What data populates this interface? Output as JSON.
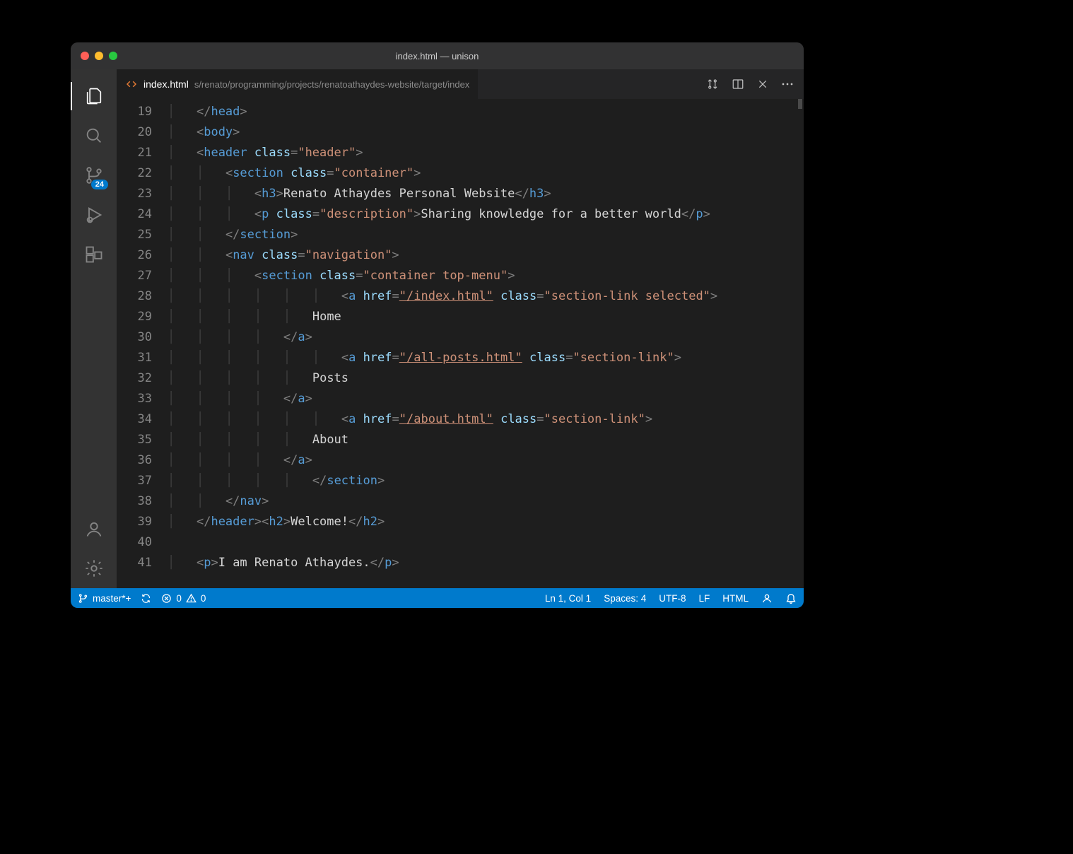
{
  "window": {
    "title": "index.html — unison"
  },
  "tab": {
    "icon": "code-icon",
    "filename": "index.html",
    "path": "s/renato/programming/projects/renatoathaydes-website/target/index"
  },
  "activity": {
    "scm_badge": "24"
  },
  "gutter": {
    "start": 19,
    "end": 41
  },
  "code_lines": [
    {
      "indent": 1,
      "open": false,
      "tag": "head",
      "self": false
    },
    {
      "indent": 1,
      "open": true,
      "tag": "body",
      "self": false
    },
    {
      "indent": 1,
      "open": true,
      "tag": "header",
      "attrs": [
        [
          "class",
          "header"
        ]
      ]
    },
    {
      "indent": 2,
      "open": true,
      "tag": "section",
      "attrs": [
        [
          "class",
          "container"
        ]
      ]
    },
    {
      "indent": 3,
      "inline_wrap": "h3",
      "text": "Renato Athaydes Personal Website"
    },
    {
      "indent": 3,
      "inline_wrap": "p",
      "inline_attrs": [
        [
          "class",
          "description"
        ]
      ],
      "text": "Sharing knowledge for a better world"
    },
    {
      "indent": 2,
      "open": false,
      "tag": "section"
    },
    {
      "indent": 2,
      "open": true,
      "tag": "nav",
      "attrs": [
        [
          "class",
          "navigation"
        ]
      ]
    },
    {
      "indent": 3,
      "open": true,
      "tag": "section",
      "attrs": [
        [
          "class",
          "container top-menu"
        ]
      ]
    },
    {
      "indent": 6,
      "open": true,
      "tag": "a",
      "attrs": [
        [
          "href",
          "/index.html",
          true
        ],
        [
          "class",
          "section-link selected"
        ]
      ]
    },
    {
      "indent": 5,
      "plain": "Home"
    },
    {
      "indent": 4,
      "open": false,
      "tag": "a"
    },
    {
      "indent": 6,
      "open": true,
      "tag": "a",
      "attrs": [
        [
          "href",
          "/all-posts.html",
          true
        ],
        [
          "class",
          "section-link"
        ]
      ]
    },
    {
      "indent": 5,
      "plain": "Posts"
    },
    {
      "indent": 4,
      "open": false,
      "tag": "a"
    },
    {
      "indent": 6,
      "open": true,
      "tag": "a",
      "attrs": [
        [
          "href",
          "/about.html",
          true
        ],
        [
          "class",
          "section-link"
        ]
      ]
    },
    {
      "indent": 5,
      "plain": "About"
    },
    {
      "indent": 4,
      "open": false,
      "tag": "a"
    },
    {
      "indent": 5,
      "open": false,
      "tag": "section"
    },
    {
      "indent": 2,
      "open": false,
      "tag": "nav"
    },
    {
      "indent": 1,
      "double": {
        "close": "header",
        "open": "h2",
        "text": "Welcome!",
        "close2": "h2"
      }
    },
    {
      "indent": 0,
      "blank": true
    },
    {
      "indent": 1,
      "inline_wrap": "p",
      "text": "I am Renato Athaydes."
    }
  ],
  "status": {
    "branch": "master*+",
    "errors": "0",
    "warnings": "0",
    "cursor": "Ln 1, Col 1",
    "indent": "Spaces: 4",
    "encoding": "UTF-8",
    "eol": "LF",
    "lang": "HTML"
  }
}
